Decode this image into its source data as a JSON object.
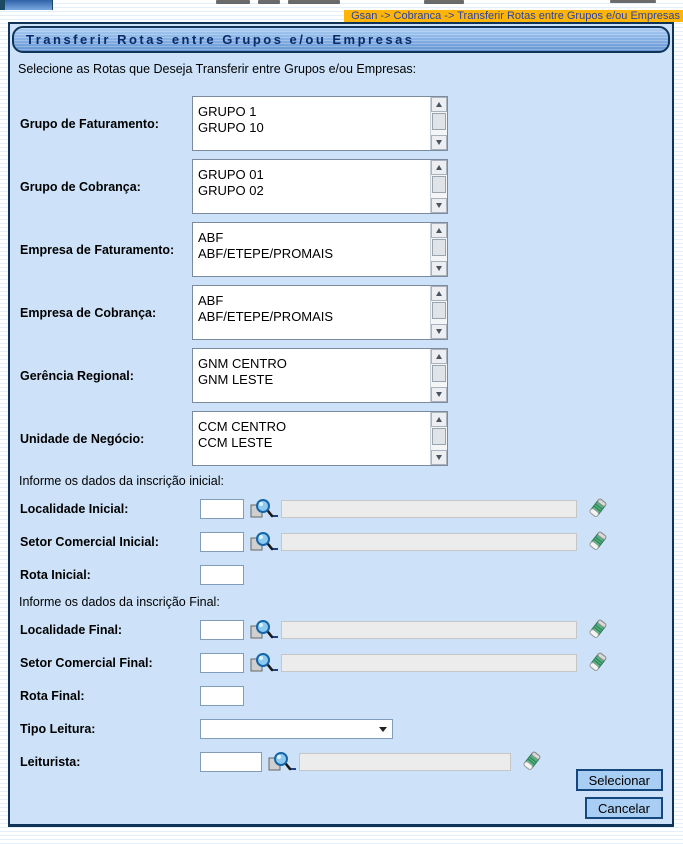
{
  "page": {
    "breadcrumb": "Gsan -> Cobranca -> Transferir Rotas entre Grupos e/ou Empresas",
    "title": "Transferir Rotas entre Grupos e/ou Empresas",
    "instruction": "Selecione as Rotas que Deseja Transferir entre Grupos e/ou Empresas:",
    "colors": {
      "breadcrumb_bg": "#ffb508",
      "breadcrumb_text": "#2742a8",
      "panel_bg": "#cde2f8",
      "panel_border": "#103457",
      "title_text": "#0a2a6a",
      "button_bg": "#a9cef3",
      "button_border": "#16467e"
    },
    "icons": {
      "lookup": "magnifier-icon",
      "clear": "eraser-icon",
      "scroll_up": "scroll-up-arrow-icon",
      "scroll_down": "scroll-down-arrow-icon",
      "select_arrow": "chevron-down-icon"
    }
  },
  "list_fields": [
    {
      "label": "Grupo de Faturamento:",
      "options": [
        "GRUPO 1",
        "GRUPO 10"
      ]
    },
    {
      "label": "Grupo de Cobrança:",
      "options": [
        "GRUPO 01",
        "GRUPO 02"
      ]
    },
    {
      "label": "Empresa de Faturamento:",
      "options": [
        "ABF",
        "ABF/ETEPE/PROMAIS"
      ]
    },
    {
      "label": "Empresa de Cobrança:",
      "options": [
        "ABF",
        "ABF/ETEPE/PROMAIS"
      ]
    },
    {
      "label": "Gerência Regional:",
      "options": [
        "GNM CENTRO",
        "GNM LESTE"
      ]
    },
    {
      "label": "Unidade de Negócio:",
      "options": [
        "CCM CENTRO",
        "CCM LESTE"
      ]
    }
  ],
  "sections": {
    "initial_header": "Informe os dados da inscrição inicial:",
    "final_header": "Informe os dados da inscrição Final:"
  },
  "fields": {
    "localidade_inicial": {
      "label": "Localidade Inicial:",
      "value": "",
      "description": ""
    },
    "setor_comercial_inicial": {
      "label": "Setor Comercial Inicial:",
      "value": "",
      "description": ""
    },
    "rota_inicial": {
      "label": "Rota Inicial:",
      "value": ""
    },
    "localidade_final": {
      "label": "Localidade Final:",
      "value": "",
      "description": ""
    },
    "setor_comercial_final": {
      "label": "Setor Comercial Final:",
      "value": "",
      "description": ""
    },
    "rota_final": {
      "label": "Rota Final:",
      "value": ""
    },
    "tipo_leitura": {
      "label": "Tipo Leitura:",
      "selected": ""
    },
    "leiturista": {
      "label": "Leiturista:",
      "value": "",
      "description": ""
    }
  },
  "buttons": {
    "selecionar": "Selecionar",
    "cancelar": "Cancelar"
  }
}
